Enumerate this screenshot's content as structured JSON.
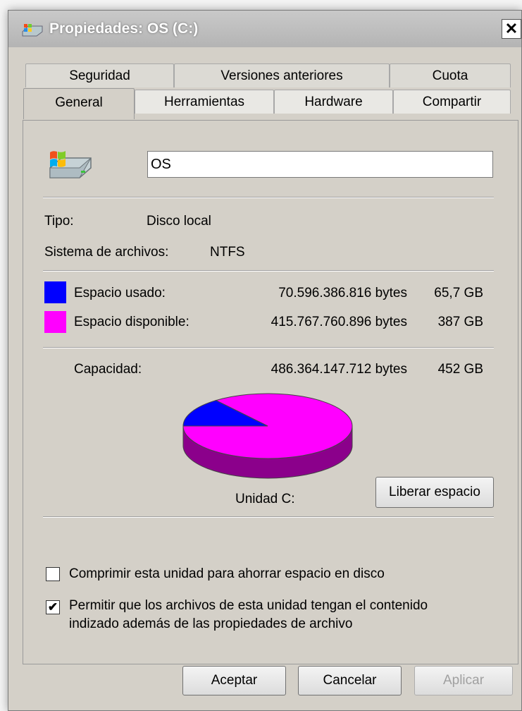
{
  "window": {
    "title": "Propiedades: OS (C:)",
    "close_glyph": "✕"
  },
  "tabs": {
    "back": [
      "Seguridad",
      "Versiones anteriores",
      "Cuota"
    ],
    "front": [
      "General",
      "Herramientas",
      "Hardware",
      "Compartir"
    ],
    "active": "General"
  },
  "general": {
    "name_value": "OS",
    "tipo_label": "Tipo:",
    "tipo_value": "Disco local",
    "fs_label": "Sistema de archivos:",
    "fs_value": "NTFS",
    "used": {
      "label": "Espacio usado:",
      "bytes": "70.596.386.816 bytes",
      "size": "65,7 GB",
      "color": "#0000ff"
    },
    "free": {
      "label": "Espacio disponible:",
      "bytes": "415.767.760.896 bytes",
      "size": "387 GB",
      "color": "#ff00ff"
    },
    "capacity": {
      "label": "Capacidad:",
      "bytes": "486.364.147.712 bytes",
      "size": "452 GB"
    },
    "drive_label": "Unidad C:",
    "cleanup_button": "Liberar espacio",
    "compress_checkbox": {
      "label": "Comprimir esta unidad para ahorrar espacio en disco",
      "checked": false
    },
    "index_checkbox": {
      "label_line1": "Permitir que los archivos de esta unidad tengan el contenido",
      "label_line2": "indizado además de las propiedades de archivo",
      "checked": true
    }
  },
  "chart_data": {
    "type": "pie",
    "labels": [
      "Espacio usado",
      "Espacio disponible"
    ],
    "values": [
      70596386816,
      415767760896
    ],
    "colors": [
      "#0000ff",
      "#ff00ff"
    ]
  },
  "buttons": {
    "ok": "Aceptar",
    "cancel": "Cancelar",
    "apply": "Aplicar"
  }
}
